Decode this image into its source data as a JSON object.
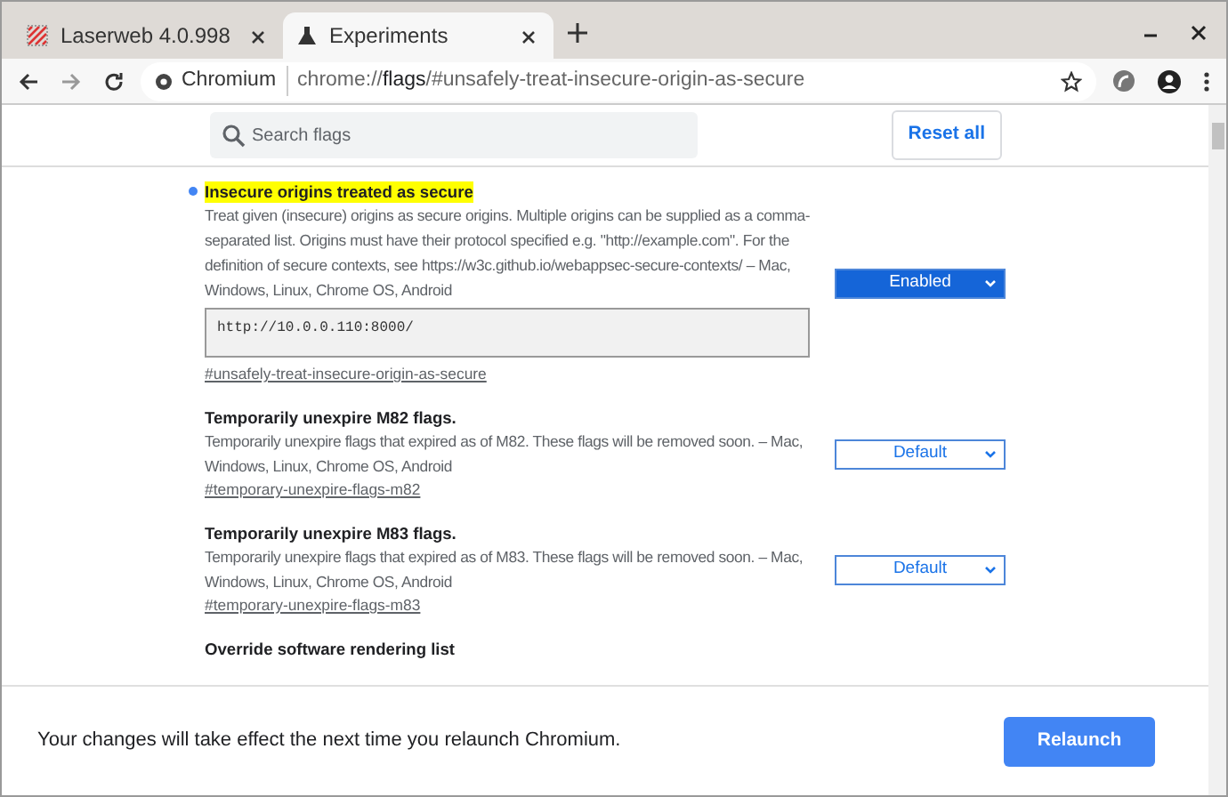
{
  "tabs": [
    {
      "label": "Laserweb 4.0.998",
      "selected": false
    },
    {
      "label": "Experiments",
      "selected": true
    }
  ],
  "toolbar": {
    "site_label": "Chromium",
    "url_prefix": "chrome://",
    "url_host": "flags",
    "url_rest": "/#unsafely-treat-insecure-origin-as-secure"
  },
  "search": {
    "placeholder": "Search flags"
  },
  "reset_button": "Reset all",
  "flags": [
    {
      "title": "Insecure origins treated as secure",
      "modified": true,
      "highlighted": true,
      "description": "Treat given (insecure) origins as secure origins. Multiple origins can be supplied as a comma-separated list. Origins must have their protocol specified e.g. \"http://example.com\". For the definition of secure contexts, see https://w3c.github.io/webappsec-secure-contexts/ – Mac, Windows, Linux, Chrome OS, Android",
      "value": "http://10.0.0.110:8000/",
      "link": "#unsafely-treat-insecure-origin-as-secure",
      "select": "Enabled"
    },
    {
      "title": "Temporarily unexpire M82 flags.",
      "modified": false,
      "highlighted": false,
      "description": "Temporarily unexpire flags that expired as of M82. These flags will be removed soon. – Mac, Windows, Linux, Chrome OS, Android",
      "link": "#temporary-unexpire-flags-m82",
      "select": "Default"
    },
    {
      "title": "Temporarily unexpire M83 flags.",
      "modified": false,
      "highlighted": false,
      "description": "Temporarily unexpire flags that expired as of M83. These flags will be removed soon. – Mac, Windows, Linux, Chrome OS, Android",
      "link": "#temporary-unexpire-flags-m83",
      "select": "Default"
    },
    {
      "title": "Override software rendering list",
      "modified": false,
      "highlighted": false
    }
  ],
  "footer": {
    "message": "Your changes will take effect the next time you relaunch Chromium.",
    "button": "Relaunch"
  }
}
